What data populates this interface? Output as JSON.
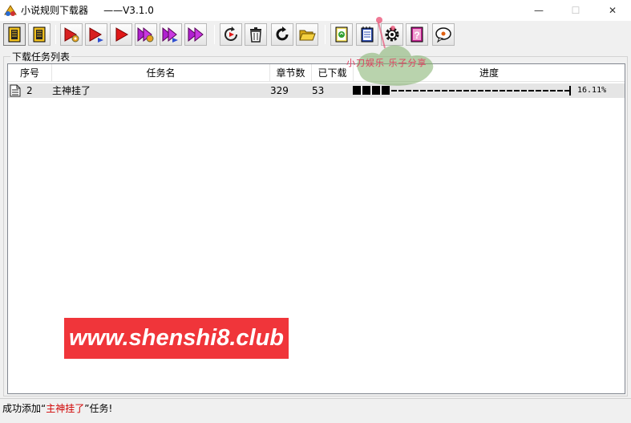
{
  "window": {
    "title": "小说规则下载器",
    "version": "——V3.1.0",
    "minimize_glyph": "—",
    "maximize_glyph": "☐",
    "close_glyph": "✕"
  },
  "toolbar": {
    "buttons": [
      {
        "name": "rules-manager",
        "icon": "book-icon-active"
      },
      {
        "name": "rules-list",
        "icon": "book-icon"
      },
      {
        "name": "start-settings",
        "icon": "play-gear-icon"
      },
      {
        "name": "start-selected",
        "icon": "play-arrow-icon"
      },
      {
        "name": "start",
        "icon": "play-icon"
      },
      {
        "name": "all-settings",
        "icon": "double-play-gear-icon"
      },
      {
        "name": "all-forward",
        "icon": "double-play-arrow-icon"
      },
      {
        "name": "all-start",
        "icon": "double-play-icon"
      },
      {
        "name": "retry",
        "icon": "refresh-play-icon"
      },
      {
        "name": "delete",
        "icon": "trash-icon"
      },
      {
        "name": "reload",
        "icon": "reload-icon"
      },
      {
        "name": "open-folder",
        "icon": "folder-icon"
      },
      {
        "name": "export",
        "icon": "export-doc-icon"
      },
      {
        "name": "notes",
        "icon": "notebook-icon"
      },
      {
        "name": "settings",
        "icon": "gear-icon"
      },
      {
        "name": "help",
        "icon": "help-book-icon"
      },
      {
        "name": "feedback",
        "icon": "chat-bubble-icon"
      }
    ]
  },
  "task_group": {
    "label": "下载任务列表",
    "columns": [
      "序号",
      "任务名",
      "章节数",
      "已下载",
      "进度"
    ],
    "rows": [
      {
        "index": "2",
        "name": "主神挂了",
        "chapters": "329",
        "downloaded": "53",
        "progress": 0.1611,
        "progress_text": "16.11%"
      }
    ]
  },
  "watermark": {
    "stamp_text": "小刀娱乐 乐子分享",
    "banner_text": "www.shenshi8.club",
    "banner_color": "#f0353a"
  },
  "status": {
    "prefix": "成功添加“",
    "highlight": "主神挂了",
    "suffix": "”任务!",
    "highlight_color": "#d00000"
  }
}
